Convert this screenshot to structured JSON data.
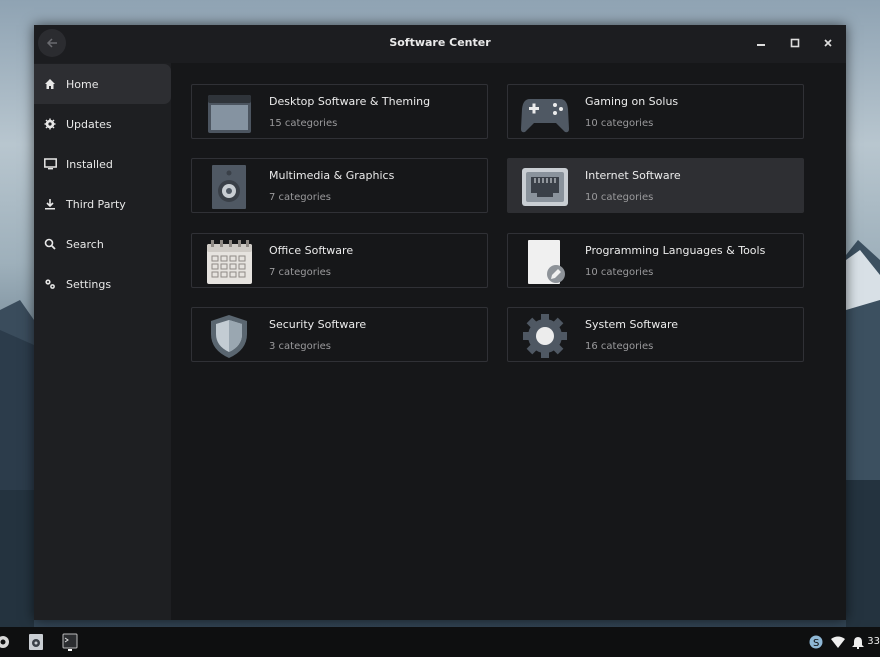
{
  "window": {
    "title": "Software Center"
  },
  "sidebar": {
    "items": [
      {
        "label": "Home",
        "icon": "home-icon"
      },
      {
        "label": "Updates",
        "icon": "gear-update-icon"
      },
      {
        "label": "Installed",
        "icon": "monitor-icon"
      },
      {
        "label": "Third Party",
        "icon": "download-icon"
      },
      {
        "label": "Search",
        "icon": "search-icon"
      },
      {
        "label": "Settings",
        "icon": "settings-icon"
      }
    ],
    "active": "Home"
  },
  "categories": [
    {
      "title": "Desktop Software & Theming",
      "subtitle": "15 categories",
      "icon": "desktop-icon"
    },
    {
      "title": "Gaming on Solus",
      "subtitle": "10 categories",
      "icon": "gamepad-icon"
    },
    {
      "title": "Multimedia & Graphics",
      "subtitle": "7 categories",
      "icon": "speaker-icon"
    },
    {
      "title": "Internet Software",
      "subtitle": "10 categories",
      "icon": "network-port-icon"
    },
    {
      "title": "Office Software",
      "subtitle": "7 categories",
      "icon": "calendar-icon"
    },
    {
      "title": "Programming Languages & Tools",
      "subtitle": "10 categories",
      "icon": "document-edit-icon"
    },
    {
      "title": "Security Software",
      "subtitle": "3 categories",
      "icon": "shield-icon"
    },
    {
      "title": "System Software",
      "subtitle": "16 categories",
      "icon": "system-gear-icon"
    }
  ],
  "selected_category": "Internet Software",
  "taskbar": {
    "clock": "33"
  },
  "colors": {
    "window_bg": "#161719",
    "sidebar_bg": "#1e1f22",
    "active_item": "#2d2e32",
    "accent_icon": "#4f5863"
  }
}
